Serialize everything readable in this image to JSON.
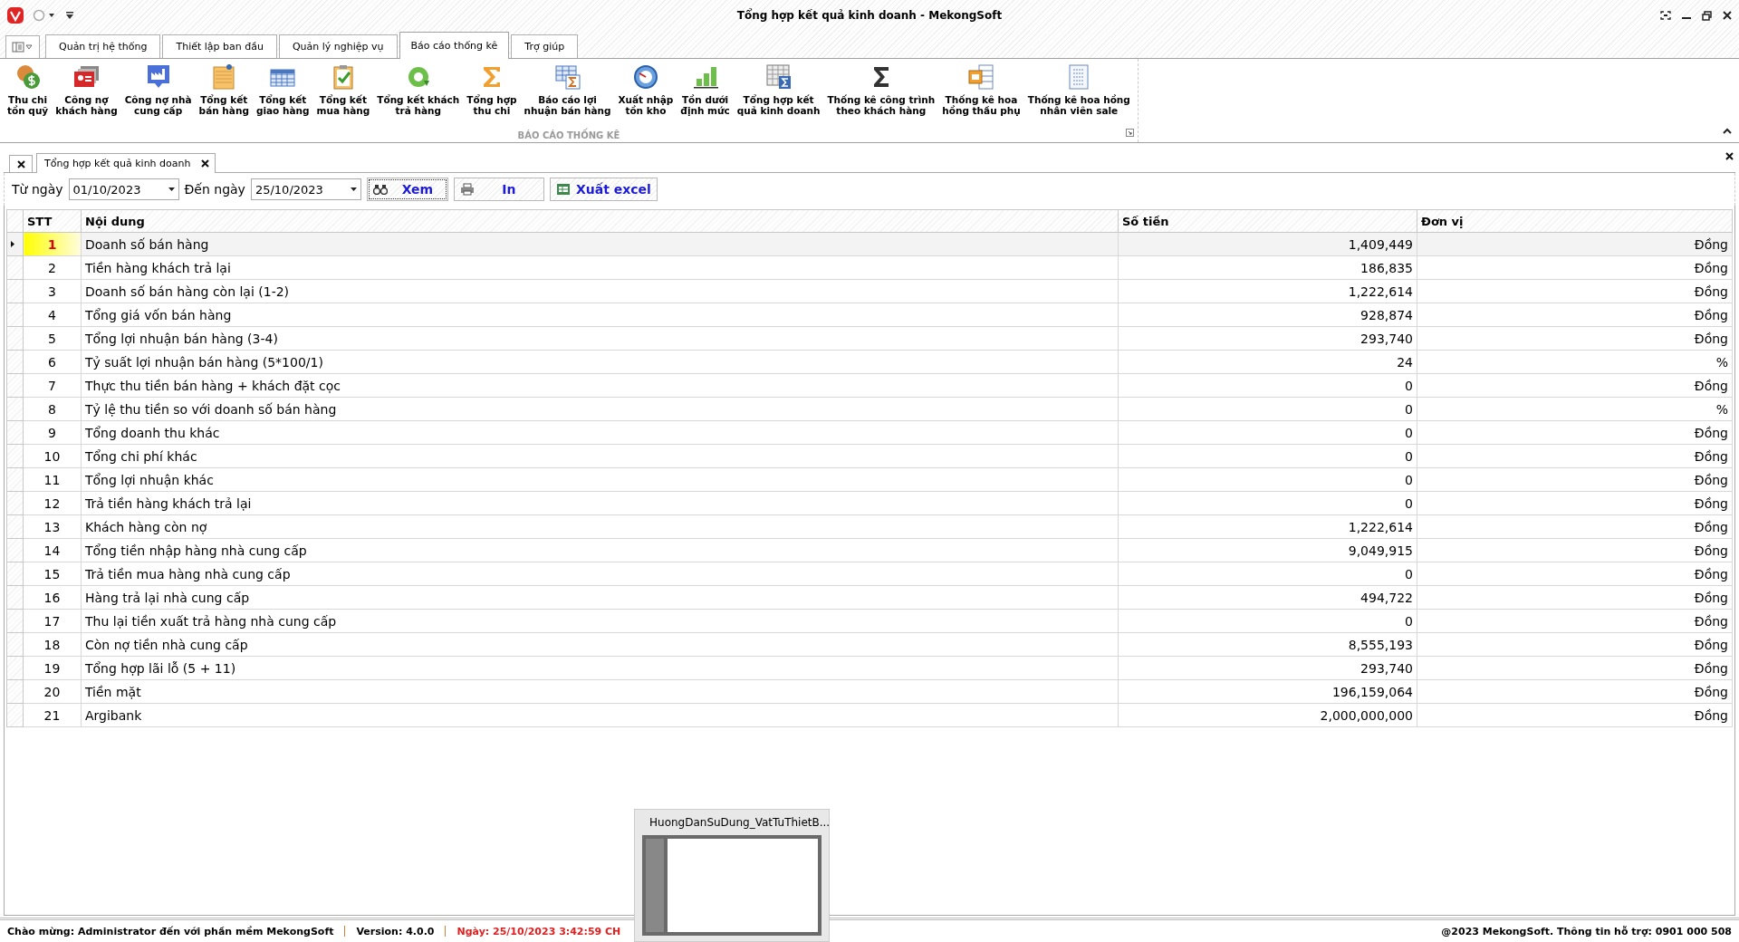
{
  "window": {
    "title": "Tổng hợp kết quả kinh doanh - MekongSoft"
  },
  "ribbon_tabs": [
    {
      "label": "Quản trị hệ thống",
      "selected": false
    },
    {
      "label": "Thiết lập ban đầu",
      "selected": false
    },
    {
      "label": "Quản lý nghiệp vụ",
      "selected": false
    },
    {
      "label": "Báo cáo thống kê",
      "selected": true
    },
    {
      "label": "Trợ giúp",
      "selected": false
    }
  ],
  "ribbon": {
    "group_title": "BÁO CÁO THỐNG KÊ",
    "buttons": [
      {
        "label": "Thu chi\ntồn quỹ"
      },
      {
        "label": "Công nợ\nkhách hàng"
      },
      {
        "label": "Công nợ nhà\ncung cấp"
      },
      {
        "label": "Tổng kết\nbán hàng"
      },
      {
        "label": "Tổng kết\ngiao hàng"
      },
      {
        "label": "Tổng kết\nmua hàng"
      },
      {
        "label": "Tổng kết khách\ntrả hàng"
      },
      {
        "label": "Tổng hợp\nthu chi"
      },
      {
        "label": "Báo cáo lợi\nnhuận bán hàng"
      },
      {
        "label": "Xuất nhập\ntồn kho"
      },
      {
        "label": "Tồn dưới\nđịnh mức"
      },
      {
        "label": "Tổng hợp kết\nquả kinh doanh"
      },
      {
        "label": "Thống kê công trình\ntheo khách hàng"
      },
      {
        "label": "Thống kê hoa\nhồng thầu phụ"
      },
      {
        "label": "Thống kê hoa hồng\nnhân viên sale"
      }
    ]
  },
  "doc_tabs": [
    {
      "label": "Tổng hợp kết quả kinh doanh",
      "selected": true
    }
  ],
  "filter": {
    "from_label": "Từ ngày",
    "from_value": "01/10/2023",
    "to_label": "Đến ngày",
    "to_value": "25/10/2023",
    "buttons": [
      "Xem",
      "In",
      "Xuất excel"
    ]
  },
  "table": {
    "columns": [
      "STT",
      "Nội dung",
      "Số tiền",
      "Đơn vị"
    ],
    "rows": [
      {
        "stt": "1",
        "content": "Doanh số bán hàng",
        "amount": "1,409,449",
        "unit": "Đồng",
        "selected": true
      },
      {
        "stt": "2",
        "content": "Tiền hàng khách trả lại",
        "amount": "186,835",
        "unit": "Đồng",
        "selected": false
      },
      {
        "stt": "3",
        "content": "Doanh số bán hàng còn lại (1-2)",
        "amount": "1,222,614",
        "unit": "Đồng",
        "selected": false
      },
      {
        "stt": "4",
        "content": "Tổng giá vốn bán hàng",
        "amount": "928,874",
        "unit": "Đồng",
        "selected": false
      },
      {
        "stt": "5",
        "content": "Tổng lợi nhuận bán hàng (3-4)",
        "amount": "293,740",
        "unit": "Đồng",
        "selected": false
      },
      {
        "stt": "6",
        "content": "Tỷ suất lợi nhuận bán hàng (5*100/1)",
        "amount": "24",
        "unit": "%",
        "selected": false
      },
      {
        "stt": "7",
        "content": "Thực thu tiền bán hàng + khách đặt cọc",
        "amount": "0",
        "unit": "Đồng",
        "selected": false
      },
      {
        "stt": "8",
        "content": "Tỷ lệ thu tiền so với doanh số bán hàng",
        "amount": "0",
        "unit": "%",
        "selected": false
      },
      {
        "stt": "9",
        "content": "Tổng doanh thu khác",
        "amount": "0",
        "unit": "Đồng",
        "selected": false
      },
      {
        "stt": "10",
        "content": "Tổng chi phí khác",
        "amount": "0",
        "unit": "Đồng",
        "selected": false
      },
      {
        "stt": "11",
        "content": "Tổng lợi nhuận khác",
        "amount": "0",
        "unit": "Đồng",
        "selected": false
      },
      {
        "stt": "12",
        "content": "Trả tiền hàng khách trả lại",
        "amount": "0",
        "unit": "Đồng",
        "selected": false
      },
      {
        "stt": "13",
        "content": "Khách hàng còn nợ",
        "amount": "1,222,614",
        "unit": "Đồng",
        "selected": false
      },
      {
        "stt": "14",
        "content": "Tổng tiền nhập hàng nhà cung cấp",
        "amount": "9,049,915",
        "unit": "Đồng",
        "selected": false
      },
      {
        "stt": "15",
        "content": "Trả tiền mua hàng nhà cung cấp",
        "amount": "0",
        "unit": "Đồng",
        "selected": false
      },
      {
        "stt": "16",
        "content": "Hàng trả lại nhà cung cấp",
        "amount": "494,722",
        "unit": "Đồng",
        "selected": false
      },
      {
        "stt": "17",
        "content": "Thu lại tiền xuất trả hàng nhà cung cấp",
        "amount": "0",
        "unit": "Đồng",
        "selected": false
      },
      {
        "stt": "18",
        "content": "Còn nợ tiền nhà cung cấp",
        "amount": "8,555,193",
        "unit": "Đồng",
        "selected": false
      },
      {
        "stt": "19",
        "content": "Tổng hợp lãi lỗ  (5 + 11)",
        "amount": "293,740",
        "unit": "Đồng",
        "selected": false
      },
      {
        "stt": "20",
        "content": "Tiền mặt",
        "amount": "196,159,064",
        "unit": "Đồng",
        "selected": false
      },
      {
        "stt": "21",
        "content": "Argibank",
        "amount": "2,000,000,000",
        "unit": "Đồng",
        "selected": false
      }
    ]
  },
  "status_bar": {
    "welcome": "Chào mừng: Administrator đến với phần mềm MekongSoft",
    "version": "Version: 4.0.0",
    "date": "Ngày: 25/10/2023 3:42:59 CH",
    "support": "@2023 MekongSoft. Thông tin hỗ trợ: 0901 000 508"
  },
  "taskbar_preview": {
    "title": "HuongDanSuDung_VatTuThietB..."
  }
}
